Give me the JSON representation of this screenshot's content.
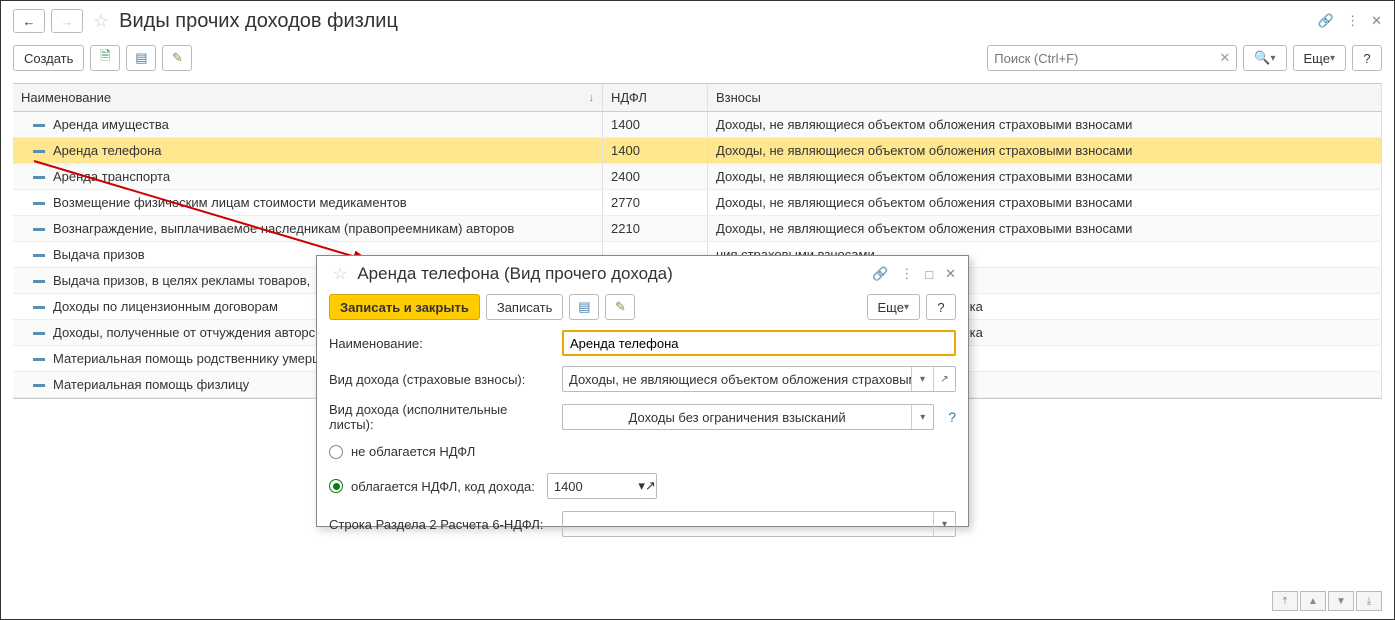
{
  "main": {
    "title": "Виды прочих доходов физлиц",
    "toolbar": {
      "create": "Создать",
      "more": "Еще"
    },
    "search": {
      "placeholder": "Поиск (Ctrl+F)"
    },
    "columns": {
      "name": "Наименование",
      "ndfl": "НДФЛ",
      "fees": "Взносы"
    },
    "rows": [
      {
        "name": "Аренда имущества",
        "ndfl": "1400",
        "fees": "Доходы, не являющиеся объектом обложения страховыми взносами"
      },
      {
        "name": "Аренда телефона",
        "ndfl": "1400",
        "fees": "Доходы, не являющиеся объектом обложения страховыми взносами",
        "selected": true
      },
      {
        "name": "Аренда транспорта",
        "ndfl": "2400",
        "fees": "Доходы, не являющиеся объектом обложения страховыми взносами"
      },
      {
        "name": "Возмещение физическим лицам стоимости медикаментов",
        "ndfl": "2770",
        "fees": "Доходы, не являющиеся объектом обложения страховыми взносами"
      },
      {
        "name": "Вознаграждение, выплачиваемое наследникам (правопреемникам) авторов",
        "ndfl": "2210",
        "fees": "Доходы, не являющиеся объектом обложения страховыми взносами"
      },
      {
        "name": "Выдача призов",
        "ndfl": "",
        "fees": "ния страховыми взносами",
        "clipped": true
      },
      {
        "name": "Выдача призов, в целях рекламы товаров,",
        "ndfl": "",
        "fees": "ния страховыми взносами",
        "clipped": true
      },
      {
        "name": "Доходы по лицензионным договорам",
        "ndfl": "",
        "fees": "ом числе для театра, кино, эстрады и цирка",
        "clipped": true
      },
      {
        "name": "Доходы, полученные от отчуждения авторск",
        "ndfl": "",
        "fees": "ом числе для театра, кино, эстрады и цирка",
        "clipped": true
      },
      {
        "name": "Материальная помощь родственнику умерш",
        "ndfl": "",
        "fees": "ния страховыми взносами",
        "clipped": true
      },
      {
        "name": "Материальная помощь физлицу",
        "ndfl": "",
        "fees": "ния страховыми взносами",
        "clipped": true
      }
    ]
  },
  "dialog": {
    "title": "Аренда телефона (Вид прочего дохода)",
    "toolbar": {
      "saveClose": "Записать и закрыть",
      "save": "Записать",
      "more": "Еще"
    },
    "labels": {
      "name": "Наименование:",
      "incomeTypeFees": "Вид дохода (страховые взносы):",
      "incomeTypeExec": "Вид дохода (исполнительные листы):",
      "notTaxed": "не облагается НДФЛ",
      "taxed": "облагается НДФЛ, код дохода:",
      "section2": "Строка Раздела 2 Расчета 6-НДФЛ:"
    },
    "values": {
      "name": "Аренда телефона",
      "incomeTypeFees": "Доходы, не являющиеся объектом обложения страховыми в",
      "incomeTypeExec": "Доходы без ограничения взысканий",
      "code": "1400",
      "section2": ""
    },
    "radio": {
      "selected": "taxed"
    }
  }
}
